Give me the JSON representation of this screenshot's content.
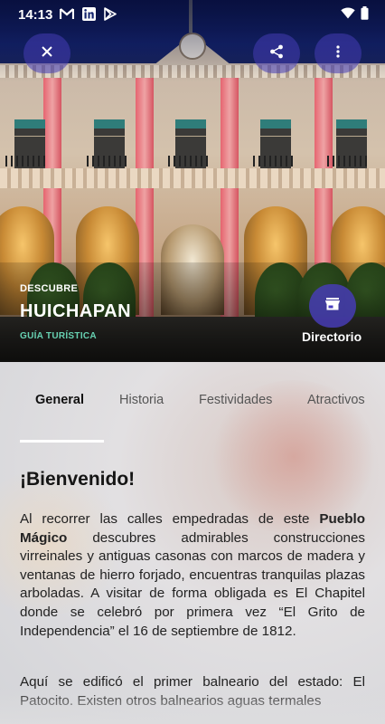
{
  "status_bar": {
    "time": "14:13",
    "notification_icons": [
      "gmail-icon",
      "linkedin-icon",
      "play-store-icon"
    ],
    "system_icons": [
      "wifi-icon",
      "battery-icon"
    ]
  },
  "hero": {
    "eyebrow": "DESCUBRE",
    "title": "HUICHAPAN",
    "subtitle": "GUÍA TURÍSTICA",
    "directory_label": "Directorio",
    "subtitle_color": "#67d1b2",
    "button_color": "#4a3fc0"
  },
  "tabs": [
    {
      "label": "General",
      "active": true
    },
    {
      "label": "Historia",
      "active": false
    },
    {
      "label": "Festividades",
      "active": false
    },
    {
      "label": "Atractivos",
      "active": false
    }
  ],
  "content": {
    "heading": "¡Bienvenido!",
    "p1_before": "Al recorrer las calles empedradas de este ",
    "p1_bold": "Pueblo Mágico",
    "p1_after": " descubres admirables construcciones virreinales y antiguas casonas con marcos de madera y ventanas de hierro forjado, encuentras tranquilas plazas arboladas. A visitar de forma obligada es El Chapitel donde se celebró por primera vez “El Grito de Independencia” el 16 de septiembre de 1812.",
    "p2": "Aquí se edificó el primer balneario del estado: El Patocito. Existen otros balnearios aguas termales"
  }
}
